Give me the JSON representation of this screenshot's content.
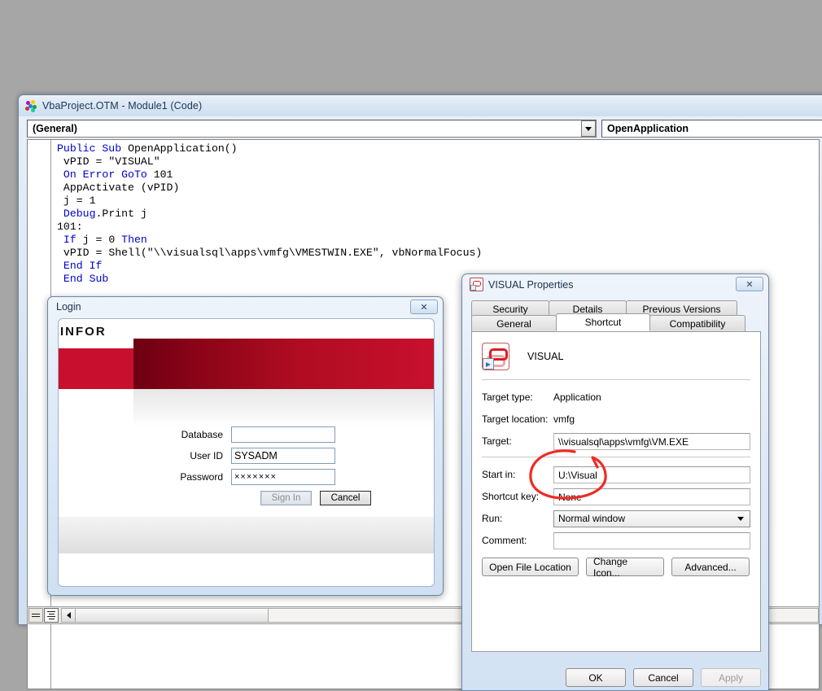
{
  "desktop": {
    "background": "#a6a6a6"
  },
  "vba": {
    "title": "VbaProject.OTM - Module1 (Code)",
    "icon": "vba-module-icon",
    "object_combo": {
      "value": "(General)",
      "arrow_icon": "chevron-down-icon"
    },
    "procedure_combo": {
      "value": "OpenApplication",
      "arrow_icon": "chevron-down-icon"
    },
    "code_lines": [
      {
        "indent": 0,
        "tokens": [
          {
            "t": "Public Sub ",
            "c": "kw"
          },
          {
            "t": "OpenApplication()",
            "c": ""
          }
        ]
      },
      {
        "indent": 1,
        "tokens": [
          {
            "t": "vPID = \"VISUAL\"",
            "c": ""
          }
        ]
      },
      {
        "indent": 1,
        "tokens": [
          {
            "t": "On Error GoTo ",
            "c": "kw"
          },
          {
            "t": "101",
            "c": ""
          }
        ]
      },
      {
        "indent": 1,
        "tokens": [
          {
            "t": "AppActivate (vPID)",
            "c": ""
          }
        ]
      },
      {
        "indent": 1,
        "tokens": [
          {
            "t": "j = 1",
            "c": ""
          }
        ]
      },
      {
        "indent": 1,
        "tokens": [
          {
            "t": "Debug",
            "c": "kw"
          },
          {
            "t": ".Print j",
            "c": ""
          }
        ]
      },
      {
        "indent": 0,
        "tokens": [
          {
            "t": "101:",
            "c": ""
          }
        ]
      },
      {
        "indent": 1,
        "tokens": [
          {
            "t": "If ",
            "c": "kw"
          },
          {
            "t": "j = 0 ",
            "c": ""
          },
          {
            "t": "Then",
            "c": "kw"
          }
        ]
      },
      {
        "indent": 1,
        "tokens": [
          {
            "t": "vPID = Shell(\"\\\\visualsql\\apps\\vmfg\\VMESTWIN.EXE\", vbNormalFocus)",
            "c": ""
          }
        ]
      },
      {
        "indent": 1,
        "tokens": [
          {
            "t": "End If",
            "c": "kw"
          }
        ]
      },
      {
        "indent": 1,
        "tokens": [
          {
            "t": "End Sub",
            "c": "kw"
          }
        ]
      }
    ],
    "view_buttons": {
      "procedure_view": "procedure-view-icon",
      "full_module_view": "full-module-view-icon"
    },
    "scrollbar": {
      "left_arrow_icon": "chevron-left-icon"
    }
  },
  "login": {
    "title": "Login",
    "close_label": "✕",
    "logo": "INFOR",
    "fields": [
      {
        "label": "Database",
        "value": "",
        "type": "text"
      },
      {
        "label": "User ID",
        "value": "SYSADM",
        "type": "text"
      },
      {
        "label": "Password",
        "value": "×××××××",
        "type": "password"
      }
    ],
    "sign_in_label": "Sign In",
    "sign_in_enabled": "false",
    "cancel_label": "Cancel",
    "accent_color": "#c8102e"
  },
  "properties": {
    "title": "VISUAL Properties",
    "close_label": "✕",
    "icon": "shortcut-icon",
    "tabs_top": [
      {
        "label": "Security",
        "active": "false",
        "width": 96
      },
      {
        "label": "Details",
        "active": "false",
        "width": 96
      },
      {
        "label": "Previous Versions",
        "active": "false",
        "width": 137
      }
    ],
    "tabs_bottom": [
      {
        "label": "General",
        "active": "false",
        "width": 105
      },
      {
        "label": "Shortcut",
        "active": "true",
        "width": 116
      },
      {
        "label": "Compatibility",
        "active": "false",
        "width": 118
      }
    ],
    "app_name": "VISUAL",
    "rows": [
      {
        "label": "Target type:",
        "value": "Application",
        "kind": "static"
      },
      {
        "label": "Target location:",
        "value": "vmfg",
        "kind": "static"
      },
      {
        "label": "Target:",
        "value": "\\\\visualsql\\apps\\vmfg\\VM.EXE",
        "kind": "input"
      },
      {
        "label": "Start in:",
        "value": "U:\\Visual",
        "kind": "input"
      },
      {
        "label": "Shortcut key:",
        "value": "None",
        "kind": "input"
      },
      {
        "label": "Run:",
        "value": "Normal window",
        "kind": "select"
      },
      {
        "label": "Comment:",
        "value": "",
        "kind": "input"
      }
    ],
    "action_buttons": [
      {
        "label": "Open File Location",
        "width": 119
      },
      {
        "label": "Change Icon...",
        "width": 96
      },
      {
        "label": "Advanced...",
        "width": 96
      }
    ],
    "footer_buttons": [
      {
        "label": "OK",
        "enabled": "true"
      },
      {
        "label": "Cancel",
        "enabled": "true"
      },
      {
        "label": "Apply",
        "enabled": "false"
      }
    ],
    "annotation": {
      "shape": "hand-drawn-ellipse",
      "color": "#ef2b24",
      "targets": "Start in field"
    }
  }
}
